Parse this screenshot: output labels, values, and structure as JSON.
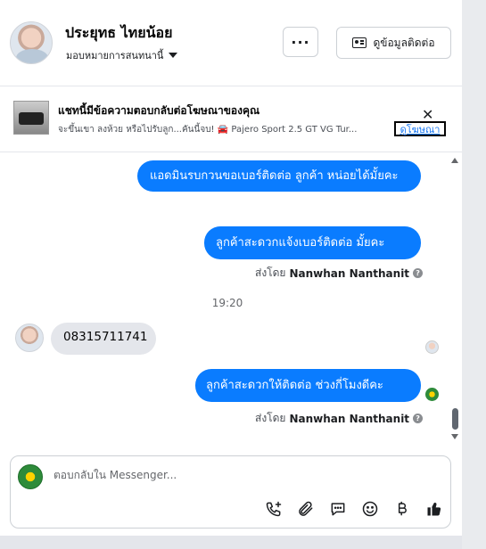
{
  "header": {
    "contact_name": "ประยุทธ ไทยน้อย",
    "subline": "มอบหมายการสนทนานี้",
    "more_label": "···",
    "contact_info_label": "ดูข้อมูลติดต่อ"
  },
  "ad_banner": {
    "title": "แชทนี้มีข้อความตอบกลับต่อโฆษณาของคุณ",
    "description": "จะขึ้นเขา ลงห้วย หรือไปรับลูก...คันนี้จบ! 🚘 Pajero Sport 2.5 GT VG Tur...",
    "view_ad_label": "ดูโฆษณา",
    "close_label": "✕"
  },
  "messages": {
    "out_1": "แอดมินรบกวนขอเบอร์ติดต่อ ลูกค้า หน่อยได้มั้ยคะ",
    "out_2": "ลูกค้าสะดวกแจ้งเบอร์ติดต่อ มั้ยคะ",
    "sent_by_prefix_1": "ส่งโดย",
    "sent_by_name_1": "Nanwhan Nanthanit",
    "time": "19:20",
    "in_1": "08315711741",
    "out_3": "ลูกค้าสะดวกให้ติดต่อ ช่วงกี่โมงดีคะ",
    "sent_by_prefix_2": "ส่งโดย",
    "sent_by_name_2": "Nanwhan Nanthanit",
    "help_glyph": "?"
  },
  "composer": {
    "placeholder": "ตอบกลับใน Messenger...",
    "tools": [
      "phone-add-icon",
      "paperclip-icon",
      "saved-reply-icon",
      "emoji-icon",
      "baht-icon",
      "thumbs-up-icon"
    ]
  },
  "colors": {
    "outgoing_bubble": "#0a7cff",
    "incoming_bubble": "#e4e6eb",
    "link": "#1877f2"
  }
}
